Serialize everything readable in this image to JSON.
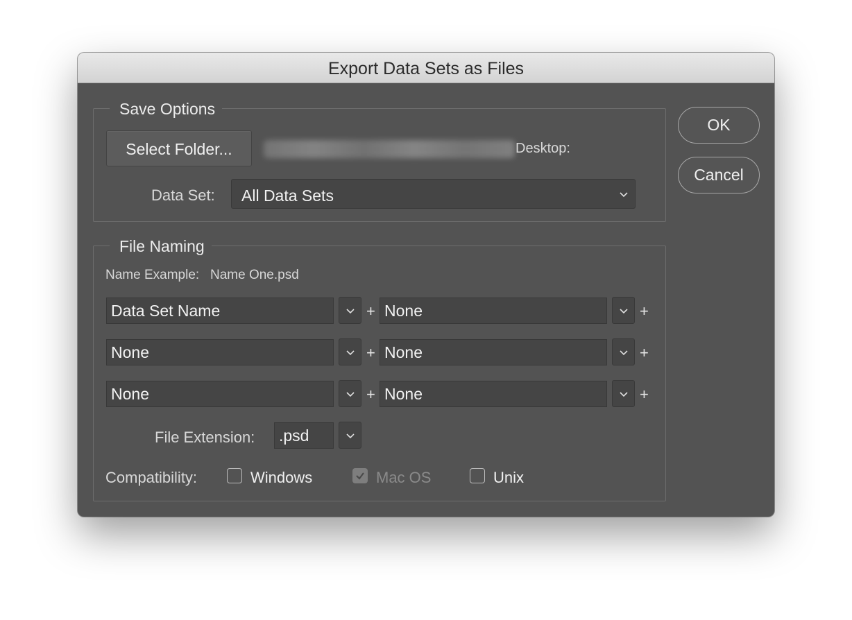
{
  "window": {
    "title": "Export Data Sets as Files"
  },
  "buttons": {
    "ok": "OK",
    "cancel": "Cancel"
  },
  "save_options": {
    "legend": "Save Options",
    "select_folder_label": "Select Folder...",
    "folder_suffix": "Desktop:",
    "data_set_label": "Data Set:",
    "data_set_value": "All Data Sets"
  },
  "file_naming": {
    "legend": "File Naming",
    "name_example_label": "Name Example:",
    "name_example_value": "Name One.psd",
    "rows": [
      {
        "left": "Data Set Name",
        "right": "None"
      },
      {
        "left": "None",
        "right": "None"
      },
      {
        "left": "None",
        "right": "None"
      }
    ],
    "plus_symbol": "+",
    "file_extension_label": "File Extension:",
    "file_extension_value": ".psd",
    "compatibility_label": "Compatibility:",
    "compatibility": [
      {
        "label": "Windows",
        "checked": false,
        "enabled": true
      },
      {
        "label": "Mac OS",
        "checked": true,
        "enabled": false
      },
      {
        "label": "Unix",
        "checked": false,
        "enabled": true
      }
    ]
  },
  "icons": {
    "dropdown": "chevron-down-icon",
    "check": "checkmark-icon"
  },
  "colors": {
    "dialog_bg": "#535353",
    "field_bg": "#454545",
    "titlebar": "#dcdcdc",
    "text": "#f0f0f0"
  }
}
